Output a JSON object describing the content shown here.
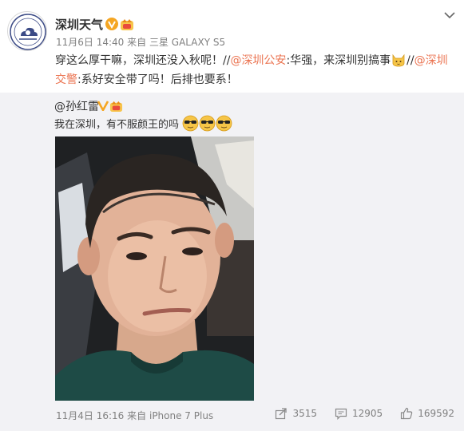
{
  "post": {
    "author": "深圳天气",
    "meta_time": "11月6日 14:40",
    "meta_from": "来自",
    "meta_device": "三星 GALAXY S5",
    "text_part1": "穿这么厚干嘛，深圳还没入秋呢！//",
    "mention1": "@深圳公安",
    "text_part2": ":华强，来深圳别搞事",
    "text_part3": "//",
    "mention2": "@深圳交警",
    "text_part4": ":系好安全带了吗！后排也要系！",
    "emoji": "cat-emoji"
  },
  "repost": {
    "author": "@孙红雷",
    "text": "我在深圳，有不服颜王的吗",
    "emoji": "cool-sunglasses-emoji",
    "time": "11月4日 16:16",
    "from": "来自",
    "device": "iPhone 7 Plus",
    "shares": "3515",
    "comments": "12905",
    "likes": "169592"
  },
  "colors": {
    "link": "#eb7350",
    "repost_bg": "#f2f2f5",
    "meta": "#808080",
    "verified": "#f5a623"
  }
}
